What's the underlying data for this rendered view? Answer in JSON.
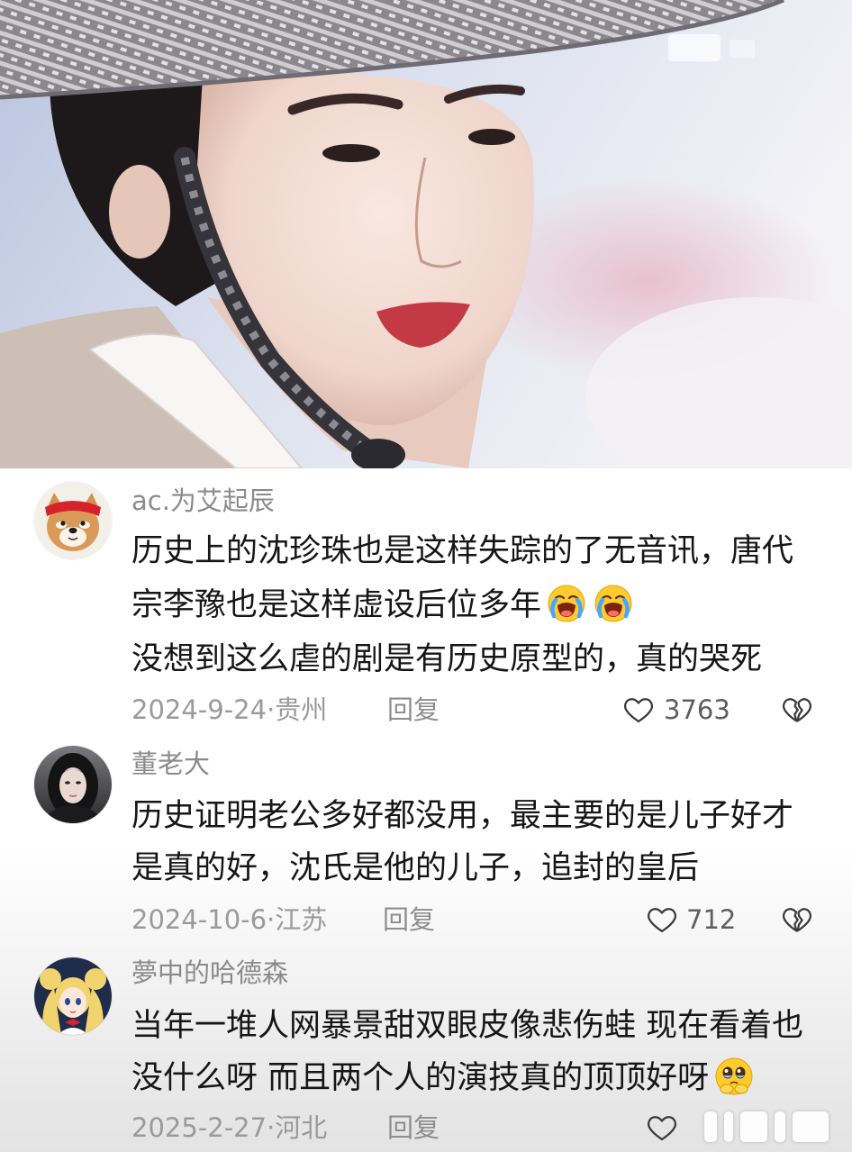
{
  "colors": {
    "body_text": "#161616",
    "username": "#8a8a8a",
    "meta": "#9a9a9a",
    "icon_stroke": "#3a3a3a",
    "accent_lips": "#c43a44"
  },
  "icons": {
    "like": "heart-outline-icon",
    "dislike": "broken-heart-icon"
  },
  "comments": [
    {
      "avatar_icon": "shiba-dog-avatar",
      "username": "ac.为艾起辰",
      "lines": [
        {
          "text": "历史上的沈珍珠也是这样失踪的了无音讯，唐代"
        },
        {
          "text": "宗李豫也是这样虚设后位多年",
          "emojis": [
            "loudly-crying-face",
            "loudly-crying-face"
          ]
        },
        {
          "text": "没想到这么虐的剧是有历史原型的，真的哭死"
        }
      ],
      "date_location": "2024-9-24·贵州",
      "reply_label": "回复",
      "like_count": "3763"
    },
    {
      "avatar_icon": "woman-portrait-avatar",
      "username": "董老大",
      "lines": [
        {
          "text": "历史证明老公多好都没用，最主要的是儿子好才"
        },
        {
          "text": "是真的好，沈氏是他的儿子，追封的皇后"
        }
      ],
      "date_location": "2024-10-6·江苏",
      "reply_label": "回复",
      "like_count": "712"
    },
    {
      "avatar_icon": "anime-girl-avatar",
      "username": "夢中的哈德森",
      "lines": [
        {
          "text": "当年一堆人网暴景甜双眼皮像悲伤蛙 现在看着也"
        },
        {
          "text": "没什么呀 而且两个人的演技真的顶顶好呀",
          "emojis": [
            "face-holding-back-tears"
          ]
        }
      ],
      "date_location": "2025-2-27·河北",
      "reply_label": "回复"
    }
  ]
}
